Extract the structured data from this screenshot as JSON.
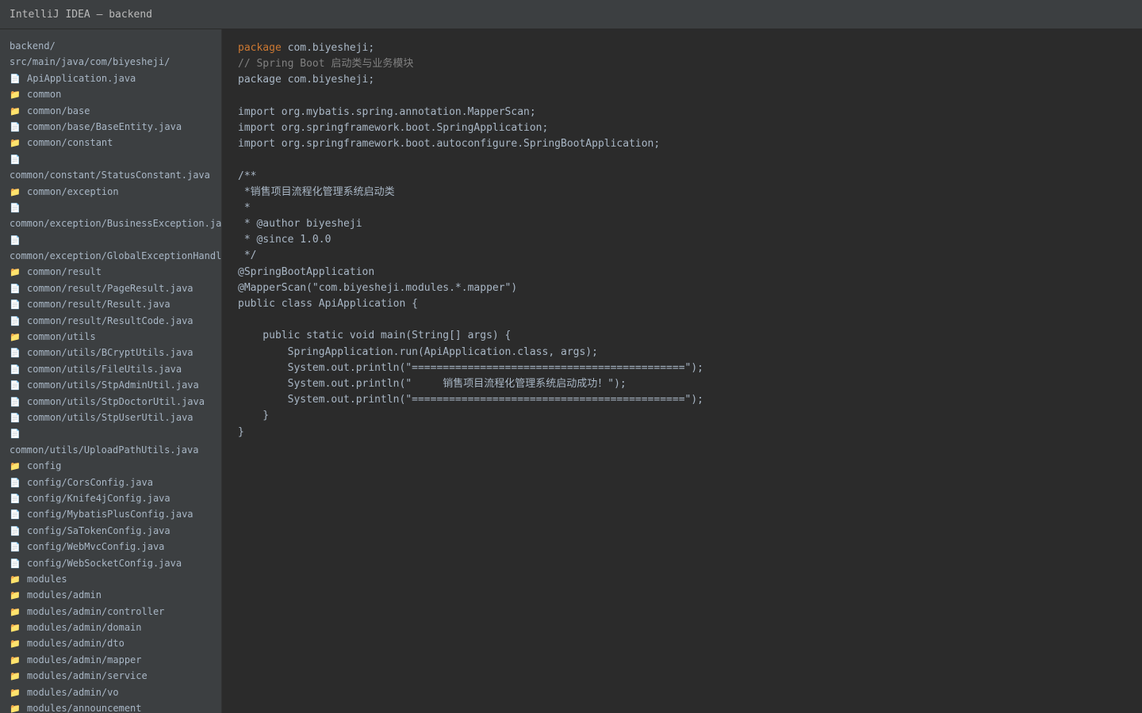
{
  "window": {
    "title": "IntelliJ IDEA — backend"
  },
  "sidebar": {
    "items": [
      {
        "icon": "",
        "text": "backend/"
      },
      {
        "icon": "",
        "text": "src/main/java/com/biyesheji/"
      },
      {
        "icon": "📄",
        "text": "ApiApplication.java"
      },
      {
        "icon": "📁",
        "text": "common"
      },
      {
        "icon": "📁",
        "text": "common/base"
      },
      {
        "icon": "📄",
        "text": "common/base/BaseEntity.java"
      },
      {
        "icon": "📁",
        "text": "common/constant"
      },
      {
        "icon": "📄",
        "text": ""
      },
      {
        "icon": "",
        "text": "common/constant/StatusConstant.java"
      },
      {
        "icon": "📁",
        "text": "common/exception"
      },
      {
        "icon": "📄",
        "text": ""
      },
      {
        "icon": "",
        "text": "common/exception/BusinessException.java"
      },
      {
        "icon": "📄",
        "text": ""
      },
      {
        "icon": "",
        "text": "common/exception/GlobalExceptionHandler.java"
      },
      {
        "icon": "📁",
        "text": "common/result"
      },
      {
        "icon": "📄",
        "text": "common/result/PageResult.java"
      },
      {
        "icon": "📄",
        "text": "common/result/Result.java"
      },
      {
        "icon": "📄",
        "text": "common/result/ResultCode.java"
      },
      {
        "icon": "📁",
        "text": "common/utils"
      },
      {
        "icon": "📄",
        "text": "common/utils/BCryptUtils.java"
      },
      {
        "icon": "📄",
        "text": "common/utils/FileUtils.java"
      },
      {
        "icon": "📄",
        "text": "common/utils/StpAdminUtil.java"
      },
      {
        "icon": "📄",
        "text": "common/utils/StpDoctorUtil.java"
      },
      {
        "icon": "📄",
        "text": "common/utils/StpUserUtil.java"
      },
      {
        "icon": "📄",
        "text": ""
      },
      {
        "icon": "",
        "text": "common/utils/UploadPathUtils.java"
      },
      {
        "icon": "📁",
        "text": "config"
      },
      {
        "icon": "📄",
        "text": "config/CorsConfig.java"
      },
      {
        "icon": "📄",
        "text": "config/Knife4jConfig.java"
      },
      {
        "icon": "📄",
        "text": "config/MybatisPlusConfig.java"
      },
      {
        "icon": "📄",
        "text": "config/SaTokenConfig.java"
      },
      {
        "icon": "📄",
        "text": "config/WebMvcConfig.java"
      },
      {
        "icon": "📄",
        "text": "config/WebSocketConfig.java"
      },
      {
        "icon": "📁",
        "text": "modules"
      },
      {
        "icon": "📁",
        "text": "modules/admin"
      },
      {
        "icon": "📁",
        "text": "modules/admin/controller"
      },
      {
        "icon": "📁",
        "text": "modules/admin/domain"
      },
      {
        "icon": "📁",
        "text": "modules/admin/dto"
      },
      {
        "icon": "📁",
        "text": "modules/admin/mapper"
      },
      {
        "icon": "📁",
        "text": "modules/admin/service"
      },
      {
        "icon": "📁",
        "text": "modules/admin/vo"
      },
      {
        "icon": "📁",
        "text": "modules/announcement"
      }
    ]
  },
  "editor": {
    "lines": [
      {
        "kw": "package",
        "text": " com.biyesheji;"
      },
      {
        "comment": "// Spring Boot 启动类与业务模块"
      },
      {
        "text": "package com.biyesheji;"
      },
      {
        "text": ""
      },
      {
        "text": "import org.mybatis.spring.annotation.MapperScan;"
      },
      {
        "text": "import org.springframework.boot.SpringApplication;"
      },
      {
        "text": "import org.springframework.boot.autoconfigure.SpringBootApplication;"
      },
      {
        "text": ""
      },
      {
        "text": "/**"
      },
      {
        "text": " *销售项目流程化管理系统启动类"
      },
      {
        "text": " *"
      },
      {
        "text": " * @author biyesheji"
      },
      {
        "text": " * @since 1.0.0"
      },
      {
        "text": " */"
      },
      {
        "text": "@SpringBootApplication"
      },
      {
        "text": "@MapperScan(\"com.biyesheji.modules.*.mapper\")"
      },
      {
        "text": "public class ApiApplication {"
      },
      {
        "text": ""
      },
      {
        "text": "    public static void main(String[] args) {"
      },
      {
        "text": "        SpringApplication.run(ApiApplication.class, args);"
      },
      {
        "text": "        System.out.println(\"============================================\");"
      },
      {
        "text": "        System.out.println(\"     销售项目流程化管理系统启动成功！\");"
      },
      {
        "text": "        System.out.println(\"============================================\");"
      },
      {
        "text": "    }"
      },
      {
        "text": "}"
      }
    ]
  },
  "colors": {
    "keyword": "#cc7832",
    "comment": "#808080",
    "text": "#a9b7c6",
    "editor_bg": "#2b2b2b",
    "panel_bg": "#3c3f41"
  },
  "icons": {
    "folder": "folder-icon",
    "file": "file-icon"
  }
}
